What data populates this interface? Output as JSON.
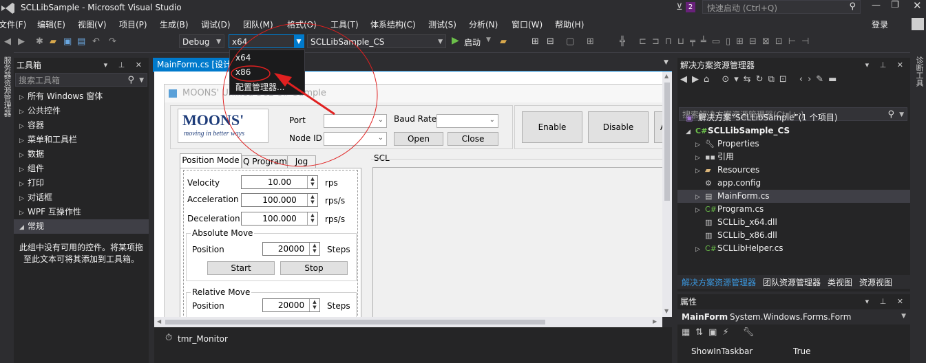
{
  "window": {
    "title": "SCLLibSample - Microsoft Visual Studio",
    "notifications": "2",
    "quick_launch": "快速启动 (Ctrl+Q)"
  },
  "menu": [
    "文件(F)",
    "编辑(E)",
    "视图(V)",
    "项目(P)",
    "生成(B)",
    "调试(D)",
    "团队(M)",
    "格式(O)",
    "工具(T)",
    "体系结构(C)",
    "测试(S)",
    "分析(N)",
    "窗口(W)",
    "帮助(H)"
  ],
  "login": "登录",
  "toolbar": {
    "config": "Debug",
    "platform": "x64",
    "project": "SCLLibSample_CS",
    "start": "启动"
  },
  "platform_dropdown": {
    "options": [
      "x64",
      "x86",
      "配置管理器..."
    ],
    "highlighted": "x86"
  },
  "left_strip": "服务器资源管理器",
  "right_strip": "诊断工具",
  "toolbox": {
    "title": "工具箱",
    "search": "搜索工具箱",
    "items": [
      "所有 Windows 窗体",
      "公共控件",
      "容器",
      "菜单和工具栏",
      "数据",
      "组件",
      "打印",
      "对话框",
      "WPF 互操作性",
      "常规"
    ],
    "empty_message": "此组中没有可用的控件。将某项拖至此文本可将其添加到工具箱。"
  },
  "editor": {
    "tab": "MainForm.cs [设计]",
    "tray_item": "tmr_Monitor"
  },
  "form": {
    "title": "MOONS' Unified SCL C# Sample",
    "logo": "MOONS'",
    "logo_tagline": "moving in better ways",
    "port_label": "Port",
    "baud_label": "Baud Rate",
    "node_label": "Node ID",
    "open_btn": "Open",
    "close_btn": "Close",
    "enable_btn": "Enable",
    "disable_btn": "Disable",
    "extra_btn": "A",
    "tabs": [
      "Position Mode",
      "Q Program",
      "Jog"
    ],
    "velocity": {
      "label": "Velocity",
      "value": "10.00",
      "unit": "rps"
    },
    "accel": {
      "label": "Acceleration",
      "value": "100.000",
      "unit": "rps/s"
    },
    "decel": {
      "label": "Deceleration",
      "value": "100.000",
      "unit": "rps/s"
    },
    "abs_group": "Absolute Move",
    "abs_pos_label": "Position",
    "abs_pos_value": "20000",
    "abs_unit": "Steps",
    "start_btn": "Start",
    "stop_btn": "Stop",
    "rel_group": "Relative Move",
    "rel_pos_label": "Position",
    "rel_pos_value": "20000",
    "rel_unit": "Steps",
    "scl_label": "SCL"
  },
  "solution": {
    "title": "解决方案资源管理器",
    "search": "搜索解决方案资源管理器(Ctrl+;)",
    "items": [
      {
        "label": "解决方案“SCLLibSample”(1 个项目)"
      },
      {
        "label": "SCLLibSample_CS"
      },
      {
        "label": "Properties"
      },
      {
        "label": "引用"
      },
      {
        "label": "Resources"
      },
      {
        "label": "app.config"
      },
      {
        "label": "MainForm.cs"
      },
      {
        "label": "Program.cs"
      },
      {
        "label": "SCLLib_x64.dll"
      },
      {
        "label": "SCLLib_x86.dll"
      },
      {
        "label": "SCLLibHelper.cs"
      }
    ],
    "bottom_tabs": [
      "解决方案资源管理器",
      "团队资源管理器",
      "类视图",
      "资源视图"
    ]
  },
  "properties": {
    "title": "属性",
    "object": "MainForm",
    "type": "System.Windows.Forms.Form",
    "row_name": "ShowInTaskbar",
    "row_value": "True"
  },
  "colors": {
    "accent": "#007acc",
    "annotation": "#e02020"
  }
}
